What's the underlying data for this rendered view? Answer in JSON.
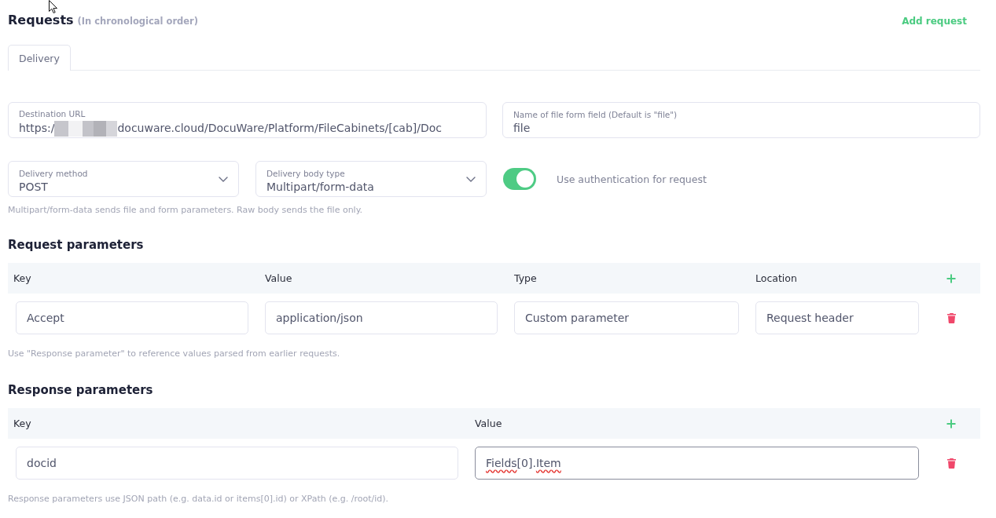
{
  "header": {
    "title": "Requests",
    "subtitle": "(In chronological order)",
    "action": "Add request"
  },
  "tabs": [
    {
      "label": "Delivery",
      "selected": true
    }
  ],
  "destination_url": {
    "label": "Destination URL",
    "value_start": "https:/",
    "redacted": true,
    "value_end": "docuware.cloud/DocuWare/Platform/FileCabinets/[cab]/Doc"
  },
  "file_form_field": {
    "label": "Name of file form field (Default is \"file\")",
    "value": "file"
  },
  "delivery_method": {
    "label": "Delivery method",
    "value": "POST"
  },
  "delivery_body_type": {
    "label": "Delivery body type",
    "value": "Multipart/form-data"
  },
  "authentication": {
    "label": "Use authentication for request",
    "on": true
  },
  "body_hint": "Multipart/form-data sends file and form parameters. Raw body sends the file only.",
  "request_parameters": {
    "title": "Request parameters",
    "columns": [
      "Key",
      "Value",
      "Type",
      "Location"
    ],
    "rows": [
      {
        "cells": [
          {
            "text": "Accept",
            "focused": false
          },
          {
            "text": "application/json",
            "focused": false
          },
          {
            "text": "Custom parameter",
            "focused": false
          },
          {
            "text": "Request header",
            "focused": false
          }
        ]
      }
    ],
    "hint": "Use \"Response parameter\" to reference values parsed from earlier requests."
  },
  "response_parameters": {
    "title": "Response parameters",
    "columns": [
      "Key",
      "Value"
    ],
    "rows": [
      {
        "cells": [
          {
            "text": "docid",
            "focused": false
          },
          {
            "segments": [
              {
                "text": "Fields",
                "misspelled": true
              },
              {
                "text": "[0].",
                "misspelled": false
              },
              {
                "text": "Item",
                "misspelled": true
              }
            ],
            "focused": true
          }
        ]
      }
    ],
    "hint": "Response parameters use JSON path (e.g. data.id or items[0].id) or XPath (e.g. /root/id)."
  }
}
